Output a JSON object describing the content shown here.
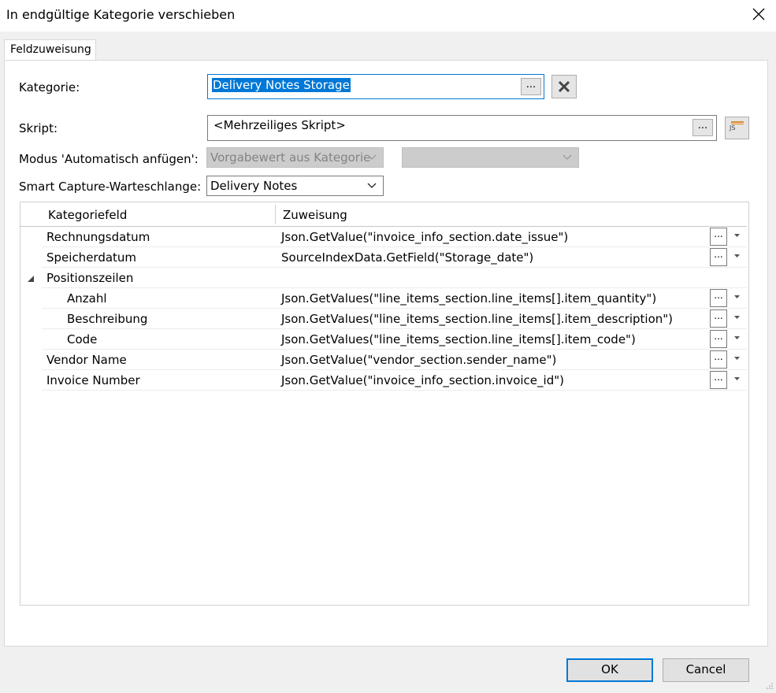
{
  "window": {
    "title": "In endgültige Kategorie verschieben"
  },
  "tabs": [
    {
      "label": "Feldzuweisung"
    }
  ],
  "form": {
    "kategorie_label": "Kategorie:",
    "kategorie_value": "Delivery Notes Storage",
    "skript_label": "Skript:",
    "skript_value": "<Mehrzeiliges Skript>",
    "modus_label": "Modus 'Automatisch anfügen':",
    "modus_value": "Vorgabewert aus Kategorie",
    "modus_second_value": "",
    "queue_label": "Smart Capture-Warteschlange:",
    "queue_value": "Delivery Notes",
    "browse_label": "...",
    "js_badge": "JS"
  },
  "grid": {
    "headers": [
      "Kategoriefeld",
      "Zuweisung"
    ],
    "rows": [
      {
        "field": "Rechnungsdatum",
        "assignment": "Json.GetValue(\"invoice_info_section.date_issue\")"
      },
      {
        "field": "Speicherdatum",
        "assignment": "SourceIndexData.GetField(\"Storage_date\")"
      },
      {
        "field": "Positionszeilen",
        "assignment": ""
      },
      {
        "field": "Anzahl",
        "assignment": "Json.GetValues(\"line_items_section.line_items[].item_quantity\")"
      },
      {
        "field": "Beschreibung",
        "assignment": "Json.GetValues(\"line_items_section.line_items[].item_description\")"
      },
      {
        "field": "Code",
        "assignment": "Json.GetValues(\"line_items_section.line_items[].item_code\")"
      },
      {
        "field": "Vendor Name",
        "assignment": "Json.GetValue(\"vendor_section.sender_name\")"
      },
      {
        "field": "Invoice Number",
        "assignment": "Json.GetValue(\"invoice_info_section.invoice_id\")"
      }
    ],
    "row_button_label": "..."
  },
  "footer": {
    "ok_label": "OK",
    "cancel_label": "Cancel"
  },
  "colors": {
    "accent": "#0078d7",
    "panel": "#ffffff",
    "chrome": "#f0f0f0"
  }
}
